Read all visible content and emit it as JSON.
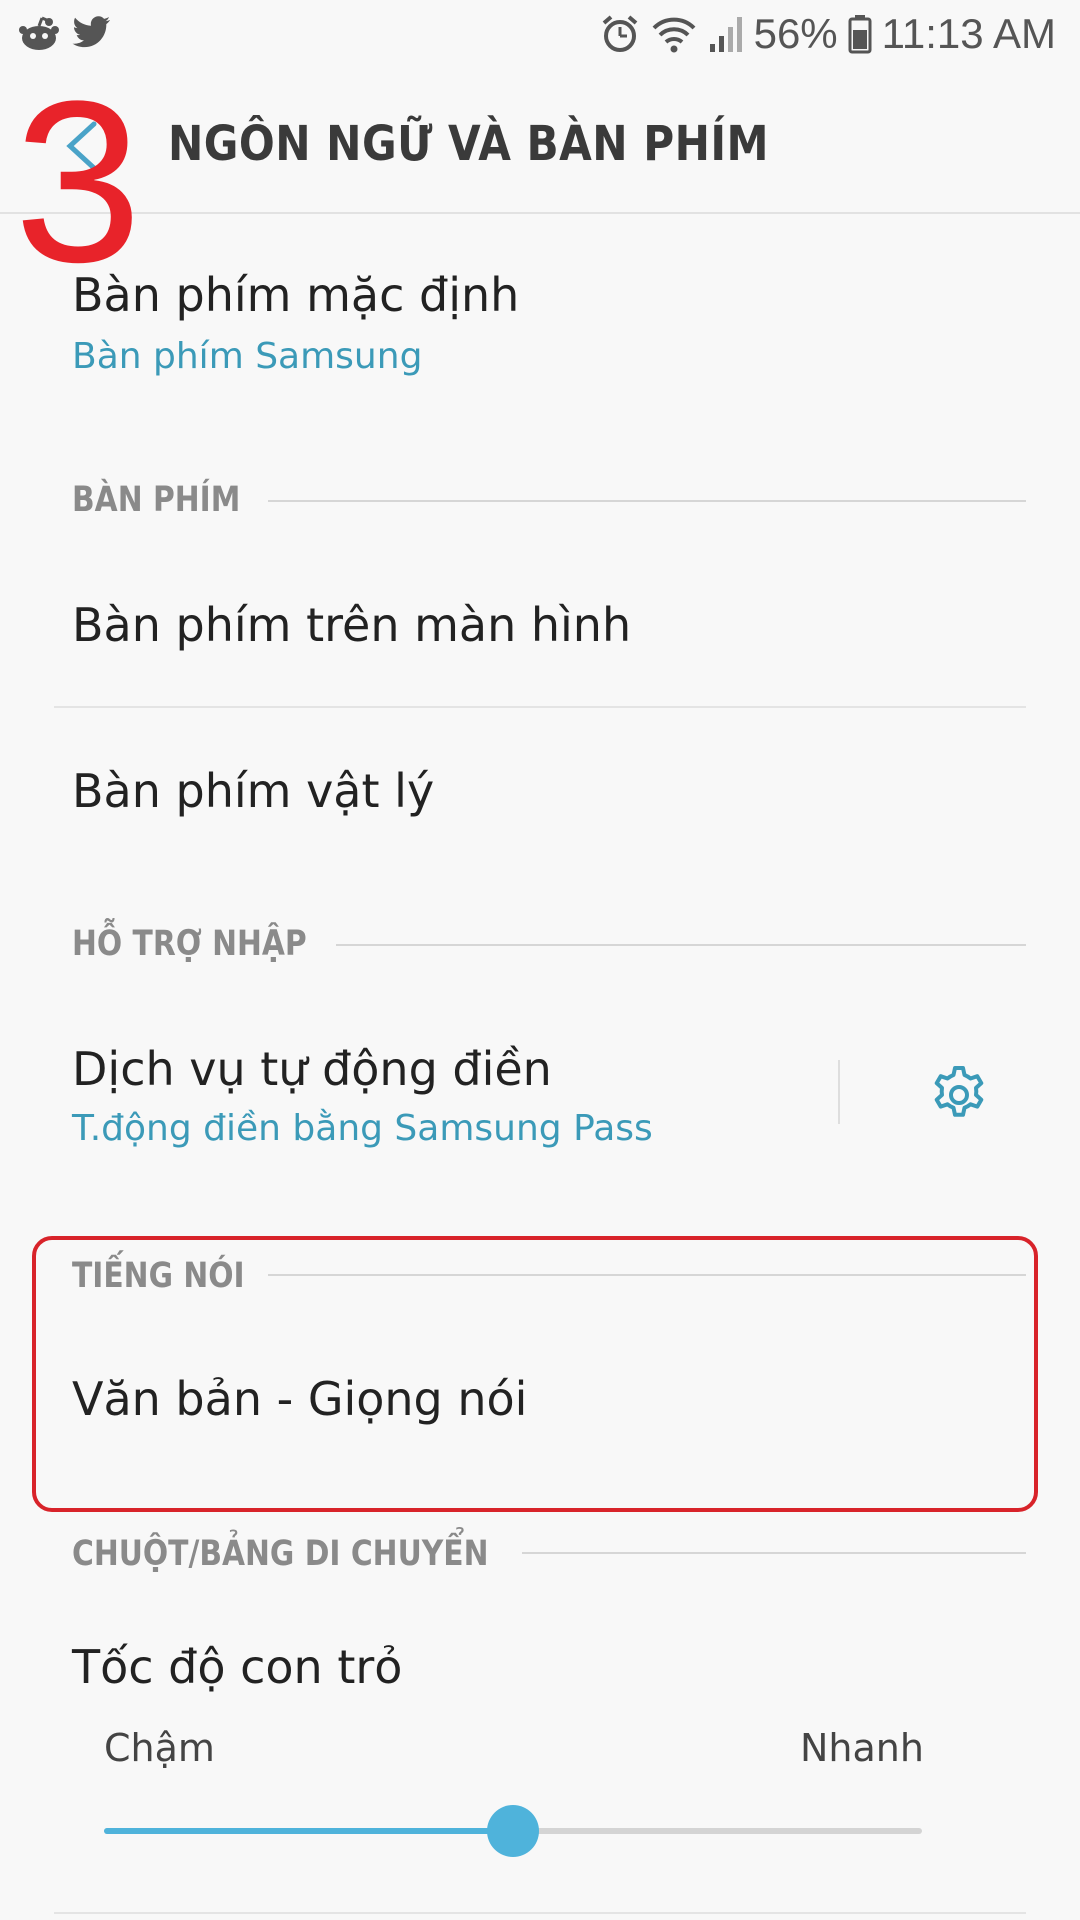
{
  "status_bar": {
    "battery": "56%",
    "time": "11:13 AM",
    "icons": [
      "reddit-icon",
      "twitter-icon",
      "alarm-icon",
      "wifi-icon",
      "signal-icon",
      "battery-icon"
    ]
  },
  "header": {
    "title": "NGÔN NGỮ VÀ BÀN PHÍM",
    "back_icon": "chevron-left-icon"
  },
  "annotation": {
    "step": "3",
    "color": "#e8232a"
  },
  "default_keyboard": {
    "title": "Bàn phím mặc định",
    "value": "Bàn phím Samsung"
  },
  "sections": {
    "keyboard": {
      "header": "BÀN PHÍM",
      "items": [
        "Bàn phím trên màn hình",
        "Bàn phím vật lý"
      ]
    },
    "input_assist": {
      "header": "HỖ TRỢ NHẬP",
      "autofill_title": "Dịch vụ tự động điền",
      "autofill_value": "T.động điền bằng Samsung Pass",
      "settings_icon": "gear-icon"
    },
    "speech": {
      "header": "TIẾNG NÓI",
      "item": "Văn bản - Giọng nói"
    },
    "pointer": {
      "header": "CHUỘT/BẢNG DI CHUYỂN",
      "speed_title": "Tốc độ con trỏ",
      "slow_label": "Chậm",
      "fast_label": "Nhanh",
      "speed_fraction": 0.5
    }
  },
  "colors": {
    "accent": "#3b9ab8",
    "slider": "#4fb3db",
    "highlight": "#d8232a"
  }
}
